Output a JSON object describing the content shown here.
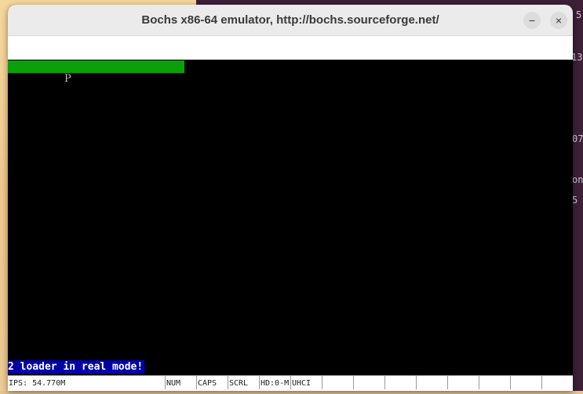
{
  "window": {
    "title": "Bochs x86-64 emulator, http://bochs.sourceforge.net/",
    "minimize_glyph": "−",
    "close_glyph": "×"
  },
  "screen": {
    "char": "P",
    "message": "2 loader in real mode!"
  },
  "statusbar": {
    "ips": "IPS: 54.770M",
    "indicators": [
      "NUM",
      "CAPS",
      "SCRL",
      "HD:0-M",
      "UHCI",
      "",
      "",
      "",
      "",
      "",
      "",
      "",
      "",
      ""
    ]
  },
  "background_terminal": {
    "fragments": [
      "5",
      "13",
      "07",
      "on",
      "5"
    ]
  },
  "colors": {
    "progress_bar": "#0aa00a",
    "message_bg": "#0000a8",
    "terminal_bg": "#3d1f38"
  }
}
